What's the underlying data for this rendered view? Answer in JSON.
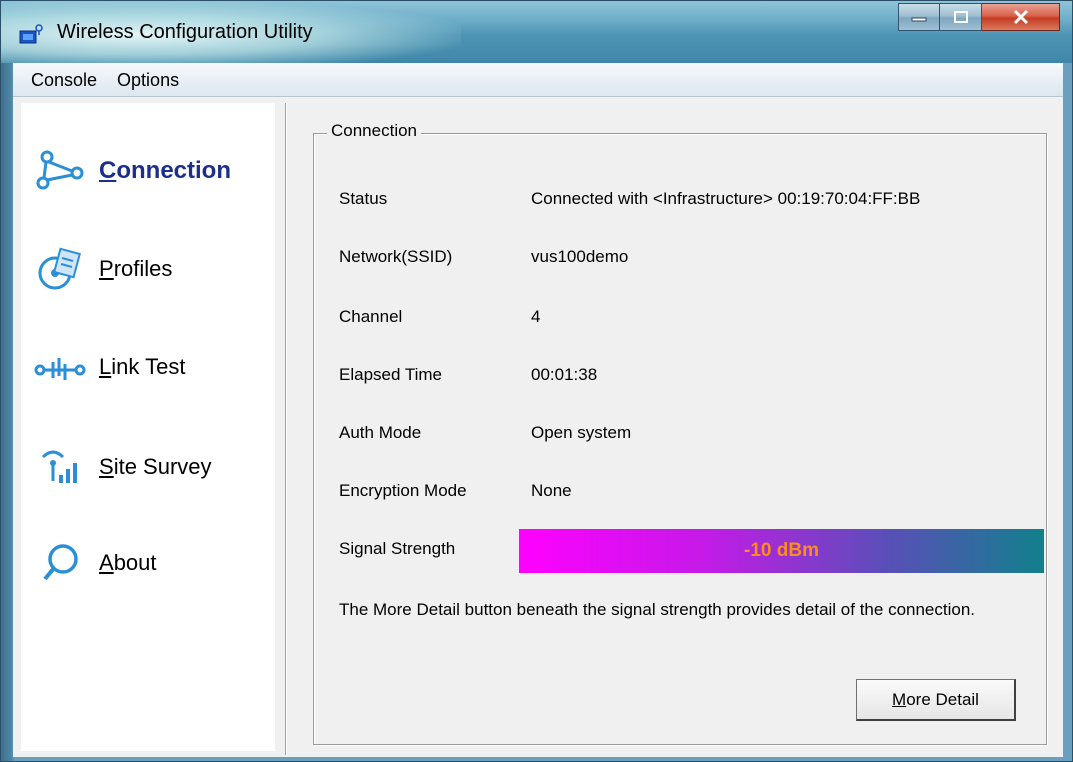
{
  "window": {
    "title": "Wireless Configuration Utility"
  },
  "menu": {
    "items": [
      "Console",
      "Options"
    ]
  },
  "sidebar": {
    "items": [
      {
        "key": "C",
        "rest": "onnection",
        "icon": "connection-icon",
        "active": true
      },
      {
        "key": "P",
        "rest": "rofiles",
        "icon": "profiles-icon",
        "active": false
      },
      {
        "key": "L",
        "rest": "ink Test",
        "icon": "link-test-icon",
        "active": false
      },
      {
        "key": "S",
        "rest": "ite Survey",
        "icon": "site-survey-icon",
        "active": false
      },
      {
        "key": "A",
        "rest": "bout",
        "icon": "about-icon",
        "active": false
      }
    ]
  },
  "connection": {
    "group_title": "Connection",
    "rows": [
      {
        "label": "Status",
        "value": "Connected with <Infrastructure> 00:19:70:04:FF:BB"
      },
      {
        "label": "Network(SSID)",
        "value": "vus100demo"
      },
      {
        "label": "Channel",
        "value": "4"
      },
      {
        "label": "Elapsed Time",
        "value": "00:01:38"
      },
      {
        "label": "Auth Mode",
        "value": "Open system"
      },
      {
        "label": "Encryption Mode",
        "value": "None"
      }
    ],
    "signal": {
      "label": "Signal Strength",
      "value": "-10 dBm"
    },
    "description": "The More Detail button beneath the signal strength provides detail of the connection.",
    "more_detail_button": {
      "key": "M",
      "rest": "ore Detail"
    }
  },
  "colors": {
    "active_nav": "#1c2f8c",
    "signal_text": "#ff8c1a",
    "signal_gradient_start": "#ff00ff",
    "signal_gradient_end": "#11808c"
  }
}
